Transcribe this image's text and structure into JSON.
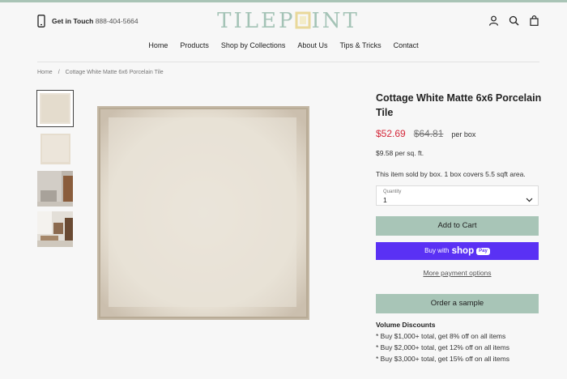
{
  "header": {
    "contact_label": "Get in Touch",
    "contact_number": "888-404-5664",
    "logo_text_left": "TILEP",
    "logo_text_right": "INT",
    "accent_color": "#a9c4b6"
  },
  "nav": [
    "Home",
    "Products",
    "Shop by Collections",
    "About Us",
    "Tips & Tricks",
    "Contact"
  ],
  "breadcrumb": {
    "home": "Home",
    "separator": "/",
    "current": "Cottage White Matte 6x6 Porcelain Tile"
  },
  "product": {
    "title": "Cottage White Matte 6x6 Porcelain Tile",
    "price_sale": "$52.69",
    "price_old": "$64.81",
    "price_unit": "per box",
    "price_sqft": "$9.58 per sq. ft.",
    "box_note": "This item sold by box. 1 box covers 5.5 sqft area.",
    "quantity_label": "Quantity",
    "quantity_value": "1",
    "add_to_cart": "Add to Cart",
    "buy_with": "Buy with",
    "shop_word": "shop",
    "pay_word": "Pay",
    "more_payment": "More payment options",
    "order_sample": "Order a sample"
  },
  "volume": {
    "title": "Volume Discounts",
    "items": [
      "* Buy $1,000+ total, get 8% off on all items",
      "* Buy $2,000+ total, get 12% off on all items",
      "* Buy $3,000+ total, get 15% off on all items"
    ]
  },
  "icons": [
    "phone-icon",
    "account-icon",
    "search-icon",
    "cart-icon",
    "chevron-down-icon"
  ]
}
